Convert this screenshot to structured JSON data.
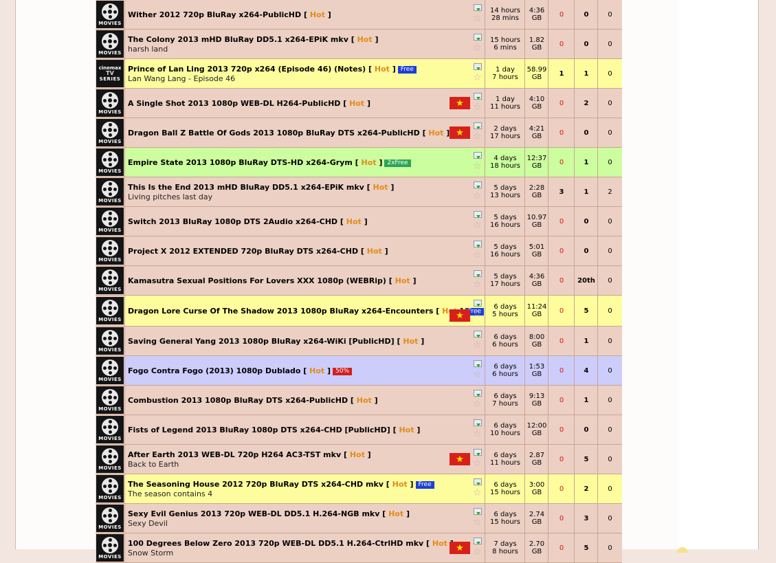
{
  "hot_label": "Hot",
  "icons": {
    "download": "download-icon",
    "bookmark": "star-icon",
    "flag": "vietnam-flag-icon",
    "category": "film-reel-icon"
  },
  "rows": [
    {
      "cat": "MOVIES",
      "title": "Wither 2012 720p BluRay x264-PublicHD",
      "sub": "",
      "badge": "",
      "badge_type": "",
      "flag": false,
      "bg": "pink",
      "age1": "14 hours",
      "age2": "28 mins",
      "size1": "4:36",
      "size2": "GB",
      "seeders": "0",
      "leechers": "0",
      "completed": "0"
    },
    {
      "cat": "MOVIES",
      "title": "The Colony 2013 mHD BluRay DD5.1 x264-EPiK mkv",
      "sub": "harsh land",
      "badge": "",
      "badge_type": "",
      "flag": false,
      "bg": "pink",
      "age1": "15 hours",
      "age2": "6 mins",
      "size1": "1.82",
      "size2": "GB",
      "seeders": "0",
      "leechers": "0",
      "completed": "0"
    },
    {
      "cat": "TV",
      "title": "Prince of Lan Ling 2013 720p x264 (Episode 46) (Notes)",
      "sub": "Lan Wang Lang - Episode 46",
      "badge": "Free",
      "badge_type": "free",
      "flag": false,
      "bg": "yellow",
      "age1": "1 day",
      "age2": "7 hours",
      "size1": "58.99",
      "size2": "GB",
      "seeders": "1",
      "leechers": "1",
      "completed": "0"
    },
    {
      "cat": "MOVIES",
      "title": "A Single Shot 2013 1080p WEB-DL H264-PublicHD",
      "sub": "",
      "badge": "",
      "badge_type": "",
      "flag": true,
      "bg": "pink",
      "age1": "1 day",
      "age2": "11 hours",
      "size1": "4:10",
      "size2": "GB",
      "seeders": "0",
      "leechers": "2",
      "completed": "0"
    },
    {
      "cat": "MOVIES",
      "title": "Dragon Ball Z Battle Of Gods 2013 1080p BluRay DTS x264-PublicHD",
      "sub": "",
      "badge": "",
      "badge_type": "",
      "flag": true,
      "bg": "pink",
      "age1": "2 days",
      "age2": "17 hours",
      "size1": "4:21",
      "size2": "GB",
      "seeders": "0",
      "leechers": "0",
      "completed": "0"
    },
    {
      "cat": "MOVIES",
      "title": "Empire State 2013 1080p BluRay DTS-HD x264-Grym",
      "sub": "",
      "badge": "2xFree",
      "badge_type": "2x",
      "flag": false,
      "bg": "green",
      "age1": "4 days",
      "age2": "18 hours",
      "size1": "12:37",
      "size2": "GB",
      "seeders": "0",
      "leechers": "1",
      "completed": "0"
    },
    {
      "cat": "MOVIES",
      "title": "This Is the End 2013 mHD BluRay DD5.1 x264-EPiK mkv",
      "sub": "Living pitches last day",
      "badge": "",
      "badge_type": "",
      "flag": false,
      "bg": "pink",
      "age1": "5 days",
      "age2": "13 hours",
      "size1": "2:28",
      "size2": "GB",
      "seeders": "3",
      "leechers": "1",
      "completed": "2"
    },
    {
      "cat": "MOVIES",
      "title": "Switch 2013 BluRay 1080p DTS 2Audio x264-CHD",
      "sub": "",
      "badge": "",
      "badge_type": "",
      "flag": false,
      "bg": "pink",
      "age1": "5 days",
      "age2": "16 hours",
      "size1": "10.97",
      "size2": "GB",
      "seeders": "0",
      "leechers": "0",
      "completed": "0"
    },
    {
      "cat": "MOVIES",
      "title": "Project X 2012 EXTENDED 720p BluRay DTS x264-CHD",
      "sub": "",
      "badge": "",
      "badge_type": "",
      "flag": false,
      "bg": "pink",
      "age1": "5 days",
      "age2": "16 hours",
      "size1": "5:01",
      "size2": "GB",
      "seeders": "0",
      "leechers": "0",
      "completed": "0"
    },
    {
      "cat": "MOVIES",
      "title": "Kamasutra Sexual Positions For Lovers XXX 1080p (WEBRip)",
      "sub": "",
      "badge": "",
      "badge_type": "",
      "flag": false,
      "bg": "pink",
      "age1": "5 days",
      "age2": "17 hours",
      "size1": "4:36",
      "size2": "GB",
      "seeders": "0",
      "leechers": "20th",
      "completed": "0"
    },
    {
      "cat": "MOVIES",
      "title": "Dragon Lore Curse Of The Shadow 2013 1080p BluRay x264-Encounters",
      "sub": "",
      "badge": "Free",
      "badge_type": "free",
      "flag": true,
      "bg": "yellow",
      "tall": true,
      "age1": "6 days",
      "age2": "5 hours",
      "size1": "11:24",
      "size2": "GB",
      "seeders": "0",
      "leechers": "5",
      "completed": "0"
    },
    {
      "cat": "MOVIES",
      "title": "Saving General Yang 2013 1080p BluRay x264-WiKi [PublicHD]",
      "sub": "",
      "badge": "",
      "badge_type": "",
      "flag": false,
      "bg": "pink",
      "age1": "6 days",
      "age2": "6 hours",
      "size1": "8:00",
      "size2": "GB",
      "seeders": "0",
      "leechers": "1",
      "completed": "0"
    },
    {
      "cat": "MOVIES",
      "title": "Fogo Contra Fogo (2013) 1080p Dublado",
      "sub": "",
      "badge": "50%",
      "badge_type": "50",
      "flag": false,
      "bg": "blue",
      "age1": "6 days",
      "age2": "6 hours",
      "size1": "1:53",
      "size2": "GB",
      "seeders": "0",
      "leechers": "4",
      "completed": "0"
    },
    {
      "cat": "MOVIES",
      "title": "Combustion 2013 1080p BluRay DTS x264-PublicHD",
      "sub": "",
      "badge": "",
      "badge_type": "",
      "flag": false,
      "bg": "pink",
      "age1": "6 days",
      "age2": "7 hours",
      "size1": "9:13",
      "size2": "GB",
      "seeders": "0",
      "leechers": "1",
      "completed": "0"
    },
    {
      "cat": "MOVIES",
      "title": "Fists of Legend 2013 BluRay 1080p DTS x264-CHD [PublicHD]",
      "sub": "",
      "badge": "",
      "badge_type": "",
      "flag": false,
      "bg": "pink",
      "age1": "6 days",
      "age2": "10 hours",
      "size1": "12:00",
      "size2": "GB",
      "seeders": "0",
      "leechers": "0",
      "completed": "0"
    },
    {
      "cat": "MOVIES",
      "title": "After Earth 2013 WEB-DL 720p H264 AC3-TST mkv",
      "sub": "Back to Earth",
      "badge": "",
      "badge_type": "",
      "flag": true,
      "bg": "pink",
      "age1": "6 days",
      "age2": "11 hours",
      "size1": "2.87",
      "size2": "GB",
      "seeders": "0",
      "leechers": "5",
      "completed": "0"
    },
    {
      "cat": "MOVIES",
      "title": "The Seasoning House 2012 720p BluRay DTS x264-CHD mkv",
      "sub": "The season contains 4",
      "badge": "Free",
      "badge_type": "free",
      "flag": false,
      "bg": "yellow",
      "age1": "6 days",
      "age2": "15 hours",
      "size1": "3:00",
      "size2": "GB",
      "seeders": "0",
      "leechers": "2",
      "completed": "0"
    },
    {
      "cat": "MOVIES",
      "title": "Sexy Evil Genius 2013 720p WEB-DL DD5.1 H.264-NGB mkv",
      "sub": "Sexy Devil",
      "badge": "",
      "badge_type": "",
      "flag": false,
      "bg": "pink",
      "age1": "6 days",
      "age2": "15 hours",
      "size1": "2.74",
      "size2": "GB",
      "seeders": "0",
      "leechers": "3",
      "completed": "0"
    },
    {
      "cat": "MOVIES",
      "title": "100 Degrees Below Zero 2013 720p WEB-DL DD5.1 H.264-CtrlHD mkv",
      "sub": "Snow Storm",
      "badge": "",
      "badge_type": "",
      "flag": true,
      "bg": "pink",
      "age1": "7 days",
      "age2": "8 hours",
      "size1": "2.70",
      "size2": "GB",
      "seeders": "0",
      "leechers": "5",
      "completed": "0"
    }
  ],
  "tv_icon": {
    "line1": "cinemax",
    "line2": "TV",
    "line3": "SERIES"
  }
}
